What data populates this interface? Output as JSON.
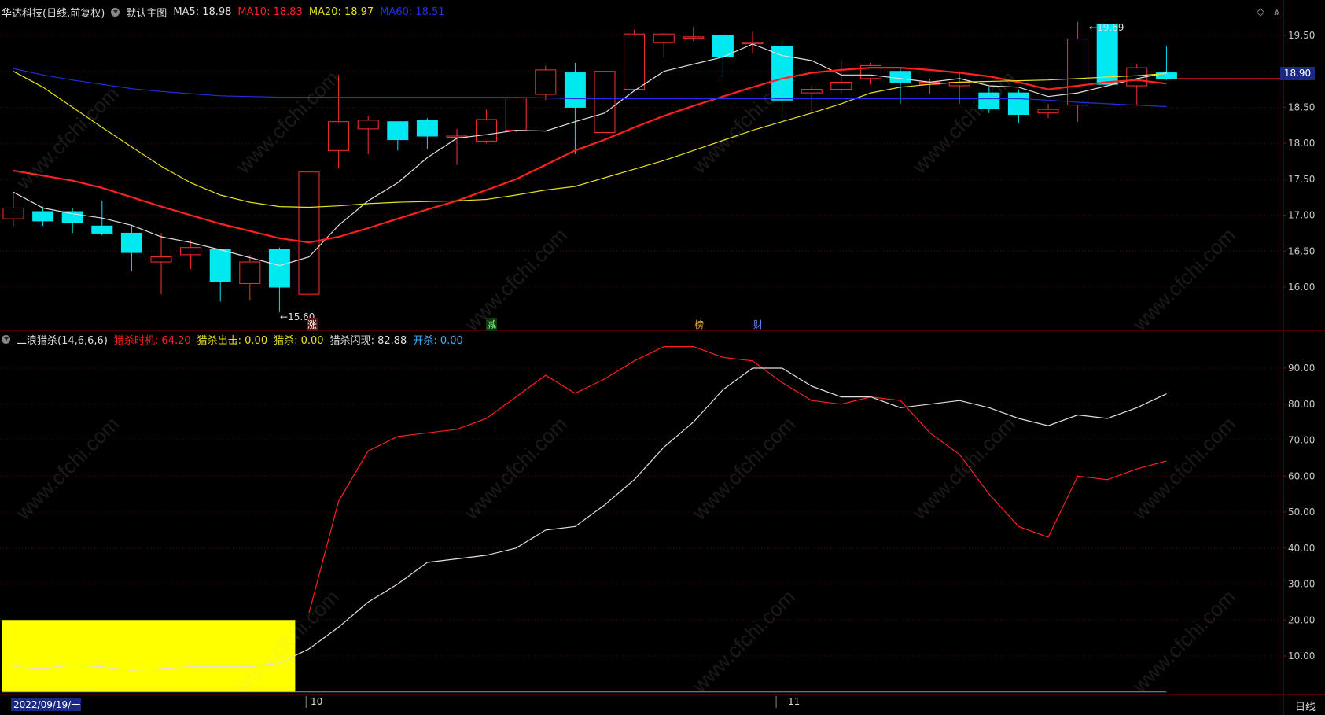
{
  "header": {
    "stock": "华达科技",
    "period_mode": "(日线,前复权)",
    "main_chart": "默认主图",
    "ma5": {
      "label": "MA5: 18.98",
      "color": "#e0e0e0"
    },
    "ma10": {
      "label": "MA10: 18.83",
      "color": "#ff2020"
    },
    "ma20": {
      "label": "MA20: 18.97",
      "color": "#e8e020"
    },
    "ma60": {
      "label": "MA60: 18.51",
      "color": "#2030e0"
    }
  },
  "indicator_header": {
    "name": "二浪猎杀(14,6,6,6)",
    "timing": {
      "label": "猎杀时机: 64.20",
      "color": "#ff2020"
    },
    "exit": {
      "label": "猎杀出击: 0.00",
      "color": "#e8e020"
    },
    "kill": {
      "label": "猎杀: 0.00",
      "color": "#e8e020"
    },
    "flash": {
      "label": "猎杀闪现: 82.88",
      "color": "#e0e0e0"
    },
    "open": {
      "label": "开杀: 0.00",
      "color": "#40b0ff"
    }
  },
  "price_axis": {
    "ticks": [
      "19.50",
      "19.00",
      "18.50",
      "18.00",
      "17.50",
      "17.00",
      "16.50",
      "16.00"
    ],
    "current": "18.90"
  },
  "indicator_axis": {
    "ticks": [
      "90.00",
      "80.00",
      "70.00",
      "60.00",
      "50.00",
      "40.00",
      "30.00",
      "20.00",
      "10.00"
    ]
  },
  "x_axis": {
    "start_date": "2022/09/19/一",
    "month_labels": [
      "10",
      "11"
    ],
    "period": "日线"
  },
  "annotations": {
    "high": "19.69",
    "low": "15.60",
    "markers": [
      "涨",
      "减",
      "榜",
      "财"
    ]
  },
  "watermark": "www.cfchi.com",
  "chart_data": [
    {
      "type": "candlestick",
      "title": "华达科技",
      "ylim": [
        15.5,
        19.7
      ],
      "candles": [
        {
          "o": 16.95,
          "c": 17.1,
          "h": 17.3,
          "l": 16.85
        },
        {
          "o": 17.05,
          "c": 16.92,
          "h": 17.12,
          "l": 16.85
        },
        {
          "o": 17.05,
          "c": 16.9,
          "h": 17.1,
          "l": 16.75
        },
        {
          "o": 16.85,
          "c": 16.75,
          "h": 17.2,
          "l": 16.72
        },
        {
          "o": 16.75,
          "c": 16.48,
          "h": 16.85,
          "l": 16.22
        },
        {
          "o": 16.35,
          "c": 16.42,
          "h": 16.75,
          "l": 15.9
        },
        {
          "o": 16.45,
          "c": 16.55,
          "h": 16.65,
          "l": 16.25
        },
        {
          "o": 16.52,
          "c": 16.08,
          "h": 16.52,
          "l": 15.8
        },
        {
          "o": 16.05,
          "c": 16.35,
          "h": 16.45,
          "l": 15.82
        },
        {
          "o": 16.52,
          "c": 16.0,
          "h": 16.55,
          "l": 15.65
        },
        {
          "o": 15.9,
          "c": 17.6,
          "h": 17.6,
          "l": 15.9
        },
        {
          "o": 17.9,
          "c": 18.3,
          "h": 18.95,
          "l": 17.65
        },
        {
          "o": 18.2,
          "c": 18.32,
          "h": 18.38,
          "l": 17.85
        },
        {
          "o": 18.3,
          "c": 18.05,
          "h": 18.3,
          "l": 17.9
        },
        {
          "o": 18.32,
          "c": 18.1,
          "h": 18.35,
          "l": 17.92
        },
        {
          "o": 18.1,
          "c": 18.1,
          "h": 18.2,
          "l": 17.7
        },
        {
          "o": 18.03,
          "c": 18.33,
          "h": 18.47,
          "l": 18.0
        },
        {
          "o": 18.18,
          "c": 18.63,
          "h": 18.65,
          "l": 18.15
        },
        {
          "o": 18.68,
          "c": 19.02,
          "h": 19.08,
          "l": 18.6
        },
        {
          "o": 18.98,
          "c": 18.5,
          "h": 19.12,
          "l": 17.85
        },
        {
          "o": 18.15,
          "c": 19.0,
          "h": 19.0,
          "l": 18.15
        },
        {
          "o": 18.75,
          "c": 19.52,
          "h": 19.58,
          "l": 18.72
        },
        {
          "o": 19.4,
          "c": 19.52,
          "h": 19.53,
          "l": 19.2
        },
        {
          "o": 19.48,
          "c": 19.48,
          "h": 19.62,
          "l": 19.42
        },
        {
          "o": 19.5,
          "c": 19.2,
          "h": 19.5,
          "l": 18.92
        },
        {
          "o": 19.4,
          "c": 19.4,
          "h": 19.55,
          "l": 19.25
        },
        {
          "o": 19.35,
          "c": 18.6,
          "h": 19.45,
          "l": 18.35
        },
        {
          "o": 18.7,
          "c": 18.75,
          "h": 18.8,
          "l": 18.45
        },
        {
          "o": 18.75,
          "c": 18.85,
          "h": 19.15,
          "l": 18.7
        },
        {
          "o": 18.9,
          "c": 19.08,
          "h": 19.12,
          "l": 18.82
        },
        {
          "o": 19.0,
          "c": 18.85,
          "h": 19.05,
          "l": 18.55
        },
        {
          "o": 18.82,
          "c": 18.85,
          "h": 18.9,
          "l": 18.68
        },
        {
          "o": 18.8,
          "c": 18.85,
          "h": 19.0,
          "l": 18.55
        },
        {
          "o": 18.7,
          "c": 18.48,
          "h": 18.78,
          "l": 18.42
        },
        {
          "o": 18.7,
          "c": 18.4,
          "h": 18.75,
          "l": 18.28
        },
        {
          "o": 18.42,
          "c": 18.47,
          "h": 18.55,
          "l": 18.35
        },
        {
          "o": 18.53,
          "c": 19.45,
          "h": 19.69,
          "l": 18.3
        },
        {
          "o": 19.65,
          "c": 18.82,
          "h": 19.65,
          "l": 18.82
        },
        {
          "o": 18.8,
          "c": 19.05,
          "h": 19.1,
          "l": 18.52
        },
        {
          "o": 18.98,
          "c": 18.9,
          "h": 19.35,
          "l": 18.88
        }
      ],
      "series": [
        {
          "name": "MA5",
          "color": "#e0e0e0",
          "values": [
            17.32,
            17.1,
            17.02,
            16.96,
            16.86,
            16.7,
            16.62,
            16.52,
            16.41,
            16.3,
            16.42,
            16.86,
            17.2,
            17.45,
            17.8,
            18.07,
            18.12,
            18.18,
            18.17,
            18.3,
            18.42,
            18.73,
            19.0,
            19.1,
            19.2,
            19.38,
            19.22,
            19.15,
            18.95,
            18.95,
            18.9,
            18.85,
            18.9,
            18.8,
            18.78,
            18.65,
            18.7,
            18.8,
            18.9,
            18.98
          ]
        },
        {
          "name": "MA10",
          "color": "#ff2020",
          "values": [
            17.62,
            17.55,
            17.48,
            17.38,
            17.25,
            17.12,
            17.0,
            16.88,
            16.78,
            16.68,
            16.62,
            16.7,
            16.82,
            16.95,
            17.08,
            17.2,
            17.35,
            17.5,
            17.7,
            17.9,
            18.05,
            18.22,
            18.38,
            18.52,
            18.65,
            18.78,
            18.9,
            18.98,
            19.02,
            19.05,
            19.05,
            19.02,
            18.98,
            18.93,
            18.85,
            18.75,
            18.8,
            18.85,
            18.88,
            18.83
          ]
        },
        {
          "name": "MA20",
          "color": "#e8e020",
          "values": [
            19.0,
            18.78,
            18.5,
            18.22,
            17.95,
            17.68,
            17.45,
            17.28,
            17.18,
            17.12,
            17.11,
            17.13,
            17.16,
            17.18,
            17.19,
            17.2,
            17.22,
            17.28,
            17.35,
            17.4,
            17.52,
            17.64,
            17.76,
            17.9,
            18.04,
            18.18,
            18.3,
            18.42,
            18.55,
            18.7,
            18.78,
            18.82,
            18.85,
            18.86,
            18.87,
            18.88,
            18.9,
            18.92,
            18.94,
            18.97
          ]
        },
        {
          "name": "MA60",
          "color": "#2030e0",
          "values": [
            19.04,
            18.95,
            18.88,
            18.82,
            18.76,
            18.72,
            18.69,
            18.66,
            18.65,
            18.64,
            18.64,
            18.64,
            18.64,
            18.64,
            18.64,
            18.64,
            18.64,
            18.64,
            18.63,
            18.62,
            18.62,
            18.62,
            18.62,
            18.62,
            18.62,
            18.62,
            18.62,
            18.62,
            18.62,
            18.62,
            18.62,
            18.62,
            18.62,
            18.62,
            18.62,
            18.6,
            18.57,
            18.55,
            18.53,
            18.51
          ]
        }
      ]
    },
    {
      "type": "line",
      "title": "二浪猎杀(14,6,6,6)",
      "ylim": [
        0,
        100
      ],
      "series": [
        {
          "name": "猎杀时机",
          "color": "#ff2020",
          "values": [
            null,
            null,
            null,
            null,
            null,
            null,
            null,
            null,
            null,
            null,
            22,
            53,
            67,
            71,
            72,
            73,
            76,
            82,
            88,
            83,
            87,
            92,
            96,
            96,
            93,
            92,
            86,
            81,
            80,
            82,
            81,
            72,
            66,
            55,
            46,
            43,
            60,
            59,
            62,
            64.2
          ]
        },
        {
          "name": "猎杀闪现",
          "color": "#e0e0e0",
          "values": [
            7,
            6.5,
            7.5,
            7,
            6,
            6.5,
            7,
            7,
            7,
            8,
            12,
            18,
            25,
            30,
            36,
            37,
            38,
            40,
            45,
            46,
            52,
            59,
            68,
            75,
            84,
            90,
            90,
            85,
            82,
            82,
            79,
            80,
            81,
            79,
            76,
            74,
            77,
            76,
            79,
            82.88
          ]
        }
      ]
    }
  ]
}
